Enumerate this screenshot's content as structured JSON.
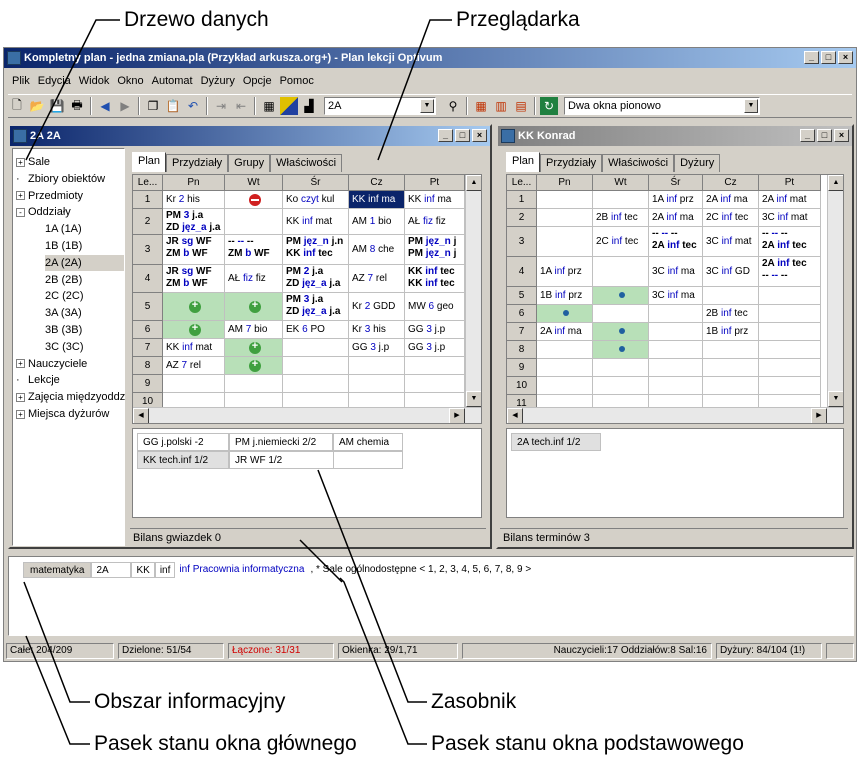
{
  "callouts": {
    "tree": "Drzewo danych",
    "browser": "Przeglądarka",
    "info": "Obszar informacyjny",
    "store": "Zasobnik",
    "main_status": "Pasek stanu okna głównego",
    "base_status": "Pasek stanu okna podstawowego"
  },
  "app": {
    "title": "Kompletny plan - jedna zmiana.pla (Przykład arkusza.org+) - Plan lekcji Optivum",
    "menu": [
      "Plik",
      "Edycja",
      "Widok",
      "Okno",
      "Automat",
      "Dyżury",
      "Opcje",
      "Pomoc"
    ],
    "toolbar": {
      "class_combo": "2A",
      "layout_combo": "Dwa okna pionowo"
    }
  },
  "left_window": {
    "title": "2A 2A",
    "tree": [
      {
        "label": "Sale",
        "expand": "+",
        "level": 0
      },
      {
        "label": "Zbiory obiektów",
        "expand": "",
        "level": 0
      },
      {
        "label": "Przedmioty",
        "expand": "+",
        "level": 0
      },
      {
        "label": "Oddziały",
        "expand": "-",
        "level": 0
      },
      {
        "label": "1A (1A)",
        "expand": "",
        "level": 1
      },
      {
        "label": "1B (1B)",
        "expand": "",
        "level": 1
      },
      {
        "label": "2A (2A)",
        "expand": "",
        "level": 1,
        "selected": true
      },
      {
        "label": "2B (2B)",
        "expand": "",
        "level": 1
      },
      {
        "label": "2C (2C)",
        "expand": "",
        "level": 1
      },
      {
        "label": "3A (3A)",
        "expand": "",
        "level": 1
      },
      {
        "label": "3B (3B)",
        "expand": "",
        "level": 1
      },
      {
        "label": "3C (3C)",
        "expand": "",
        "level": 1
      },
      {
        "label": "Nauczyciele",
        "expand": "+",
        "level": 0
      },
      {
        "label": "Lekcje",
        "expand": "",
        "level": 0
      },
      {
        "label": "Zajęcia międzyoddz",
        "expand": "+",
        "level": 0
      },
      {
        "label": "Miejsca dyżurów",
        "expand": "+",
        "level": 0
      }
    ],
    "tabs": [
      "Plan",
      "Przydziały",
      "Grupy",
      "Właściwości"
    ],
    "columns": [
      "Le...",
      "Pn",
      "Wt",
      "Śr",
      "Cz",
      "Pt"
    ],
    "rows": [
      {
        "n": "1",
        "cells": [
          "Kr 2 his",
          "RED",
          "Ko czyt kul",
          "KK inf ma",
          "KK inf ma"
        ]
      },
      {
        "n": "2",
        "cells": [
          "PM 3 j.a|ZD jęz_a j.a",
          "",
          "KK inf mat",
          "AM 1 bio",
          "AŁ fiz fiz"
        ]
      },
      {
        "n": "3",
        "cells": [
          "JR sg WF|ZM b WF",
          "-- -- --|ZM b WF",
          "PM jęz_n j.n|KK inf tec",
          "AM 8 che",
          "PM jęz_n j|PM jęz_n j"
        ]
      },
      {
        "n": "4",
        "cells": [
          "JR sg WF|ZM b WF",
          "AŁ fiz fiz",
          "PM 2 j.a|ZD jęz_a j.a",
          "AZ 7 rel",
          "KK inf tec|KK inf tec"
        ]
      },
      {
        "n": "5",
        "cells": [
          "GREEN",
          "GREEN",
          "PM 3 j.a|ZD jęz_a j.a",
          "Kr 2 GDD",
          "MW 6 geo"
        ]
      },
      {
        "n": "6",
        "cells": [
          "GREEN",
          "AM 7 bio",
          "EK 6 PO",
          "Kr 3 his",
          "GG 3 j.p"
        ]
      },
      {
        "n": "7",
        "cells": [
          "KK inf mat",
          "GREEN",
          "",
          "GG 3 j.p",
          "GG 3 j.p"
        ]
      },
      {
        "n": "8",
        "cells": [
          "AZ 7 rel",
          "GREEN",
          "",
          "",
          ""
        ]
      },
      {
        "n": "9",
        "cells": [
          "",
          "",
          "",
          "",
          ""
        ]
      },
      {
        "n": "10",
        "cells": [
          "",
          "",
          "",
          "",
          ""
        ]
      }
    ],
    "store": [
      [
        "GG j.polski -2",
        "PM j.niemiecki 2/2",
        "AM chemia"
      ],
      [
        "KK tech.inf 1/2",
        "JR WF 1/2",
        ""
      ]
    ],
    "status": "Bilans gwiazdek 0"
  },
  "right_window": {
    "title": "KK Konrad",
    "tabs": [
      "Plan",
      "Przydziały",
      "Właściwości",
      "Dyżury"
    ],
    "columns": [
      "Le...",
      "Pn",
      "Wt",
      "Śr",
      "Cz",
      "Pt"
    ],
    "rows": [
      {
        "n": "1",
        "cells": [
          "",
          "",
          "1A inf prz",
          "2A inf ma",
          "2A inf mat"
        ]
      },
      {
        "n": "2",
        "cells": [
          "",
          "2B inf tec",
          "2A inf ma",
          "2C inf tec",
          "3C inf mat"
        ]
      },
      {
        "n": "3",
        "cells": [
          "",
          "2C inf tec",
          "-- -- --|2A inf tec",
          "3C inf mat",
          "-- -- --|2A inf tec"
        ]
      },
      {
        "n": "4",
        "cells": [
          "1A inf prz",
          "",
          "3C inf ma",
          "3C inf GD",
          "2A inf tec|-- -- --"
        ]
      },
      {
        "n": "5",
        "cells": [
          "1B inf prz",
          "DOT",
          "3C inf ma",
          "",
          ""
        ]
      },
      {
        "n": "6",
        "cells": [
          "DOT",
          "",
          "",
          "2B inf tec",
          ""
        ]
      },
      {
        "n": "7",
        "cells": [
          "2A inf ma",
          "DOT",
          "",
          "1B inf prz",
          ""
        ]
      },
      {
        "n": "8",
        "cells": [
          "",
          "DOT",
          "",
          "",
          ""
        ]
      },
      {
        "n": "9",
        "cells": [
          "",
          "",
          "",
          "",
          ""
        ]
      },
      {
        "n": "10",
        "cells": [
          "",
          "",
          "",
          "",
          ""
        ]
      },
      {
        "n": "11",
        "cells": [
          "",
          "",
          "",
          "",
          ""
        ]
      }
    ],
    "store": [
      "2A tech.inf 1/2"
    ],
    "status": "Bilans terminów 3"
  },
  "info_area": {
    "subject": "matematyka",
    "class": "2A",
    "teacher": "KK",
    "room": "inf",
    "room_full": "inf Pracownia informatyczna",
    "rest": ", * Sale ogólnodostępne < 1, 2, 3, 4, 5, 6, 7, 8, 9 >"
  },
  "main_status": {
    "cale": "Całe: 204/209",
    "dzielone": "Dzielone: 51/54",
    "laczone": "Łączone: 31/31",
    "okienka": "Okienka: 29/1,71",
    "summary": "Nauczycieli:17  Oddziałów:8  Sal:16",
    "dyzury": "Dyżury: 84/104 (1!)"
  },
  "colors": {
    "title_active": "#0a246a",
    "selected_cell": "#0a246a",
    "red_text": "#d00000",
    "green_cell": "#b8e0b8"
  }
}
